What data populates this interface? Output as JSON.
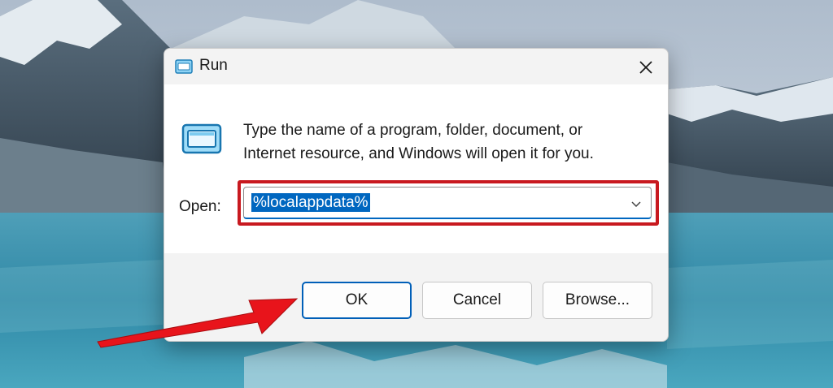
{
  "window": {
    "title": "Run",
    "close_icon": "close-icon",
    "app_icon": "run-app-icon"
  },
  "content": {
    "description_line1": "Type the name of a program, folder, document, or",
    "description_line2": "Internet resource, and Windows will open it for you.",
    "open_label": "Open:",
    "open_value": "%localappdata%",
    "dropdown_icon": "chevron-down-icon"
  },
  "buttons": {
    "ok": "OK",
    "cancel": "Cancel",
    "browse": "Browse..."
  },
  "colors": {
    "highlight_border": "#c8191f",
    "selection": "#0067c0",
    "arrow": "#e8141b"
  }
}
